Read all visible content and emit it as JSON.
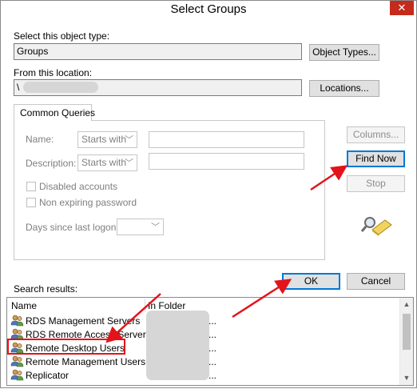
{
  "window": {
    "title": "Select Groups",
    "close_symbol": "✕"
  },
  "object_type": {
    "label": "Select this object type:",
    "value": "Groups",
    "button": "Object Types..."
  },
  "location": {
    "label": "From this location:",
    "value": "\\",
    "button": "Locations..."
  },
  "common_queries": {
    "tab": "Common Queries",
    "name_label": "Name:",
    "name_mode": "Starts with",
    "description_label": "Description:",
    "description_mode": "Starts with",
    "disabled_accounts": "Disabled accounts",
    "non_expiring_password": "Non expiring password",
    "days_label": "Days since last logon:"
  },
  "side_buttons": {
    "columns": "Columns...",
    "find_now": "Find Now",
    "stop": "Stop"
  },
  "dialog_buttons": {
    "ok": "OK",
    "cancel": "Cancel"
  },
  "results": {
    "label": "Search results:",
    "columns": [
      "Name",
      "In Folder"
    ],
    "rows": [
      {
        "name": "RDS Management Servers",
        "folder": "..."
      },
      {
        "name": "RDS Remote Access Servers",
        "folder": "..."
      },
      {
        "name": "Remote Desktop Users",
        "folder": "..."
      },
      {
        "name": "Remote Management Users",
        "folder": "..."
      },
      {
        "name": "Replicator",
        "folder": "..."
      }
    ],
    "scroll_up": "▲",
    "scroll_down": "▼"
  },
  "colors": {
    "highlight": "#e3131b",
    "default_button": "#0078d7"
  }
}
